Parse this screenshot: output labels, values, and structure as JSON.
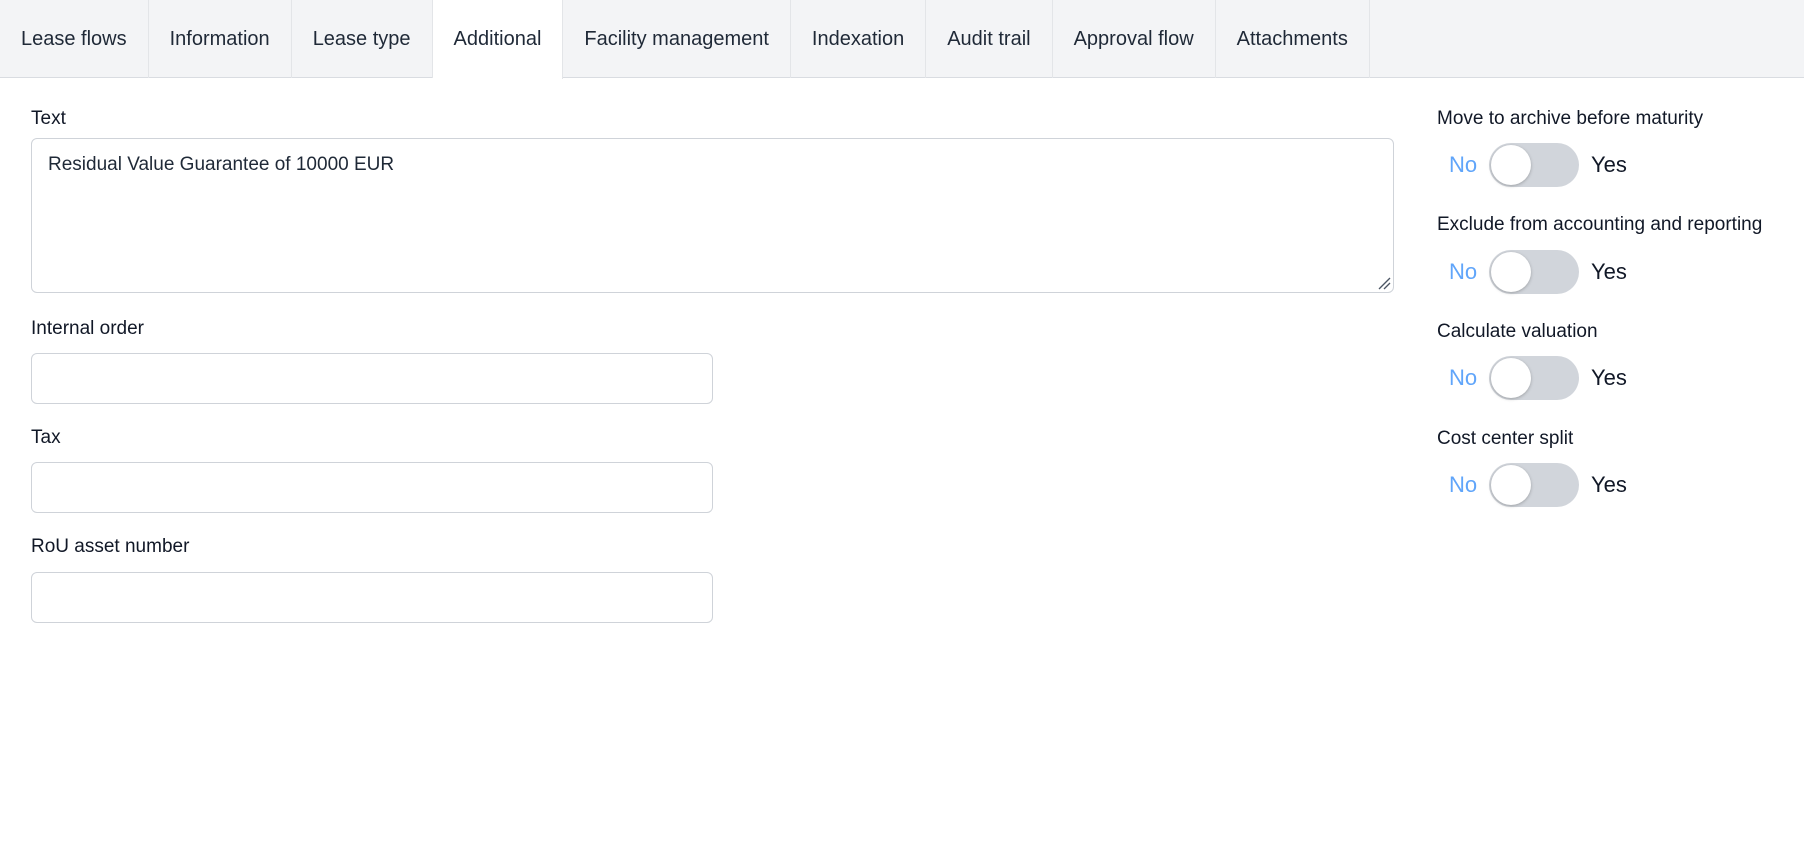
{
  "tabs": [
    {
      "label": "Lease flows",
      "active": false
    },
    {
      "label": "Information",
      "active": false
    },
    {
      "label": "Lease type",
      "active": false
    },
    {
      "label": "Additional",
      "active": true
    },
    {
      "label": "Facility management",
      "active": false
    },
    {
      "label": "Indexation",
      "active": false
    },
    {
      "label": "Audit trail",
      "active": false
    },
    {
      "label": "Approval flow",
      "active": false
    },
    {
      "label": "Attachments",
      "active": false
    }
  ],
  "form": {
    "text_label": "Text",
    "text_value": "Residual Value Guarantee of 10000 EUR",
    "internal_order_label": "Internal order",
    "internal_order_value": "",
    "tax_label": "Tax",
    "tax_value": "",
    "rou_label": "RoU asset number",
    "rou_value": ""
  },
  "toggles": [
    {
      "label": "Move to archive before maturity",
      "no": "No",
      "yes": "Yes",
      "value": false
    },
    {
      "label": "Exclude from accounting and reporting",
      "no": "No",
      "yes": "Yes",
      "value": false
    },
    {
      "label": "Calculate valuation",
      "no": "No",
      "yes": "Yes",
      "value": false
    },
    {
      "label": "Cost center split",
      "no": "No",
      "yes": "Yes",
      "value": false
    }
  ],
  "colors": {
    "tabbar_bg": "#f3f4f6",
    "no_text": "#60a5fa",
    "switch_off": "#d1d5db"
  }
}
